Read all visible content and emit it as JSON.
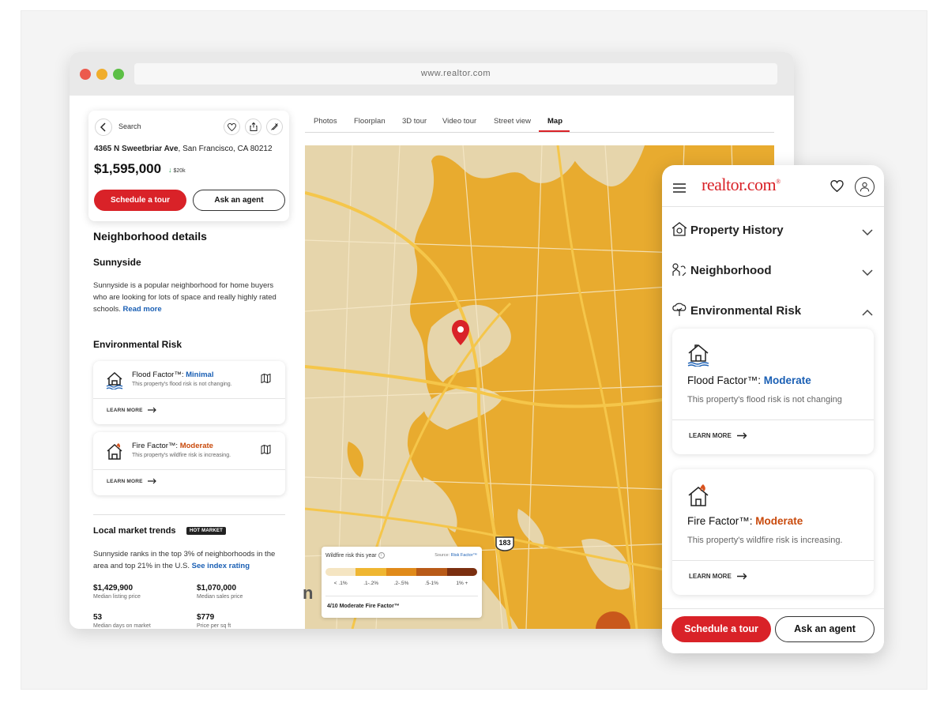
{
  "browser": {
    "url": "www.realtor.com"
  },
  "listing": {
    "back_label": "Search",
    "address_bold": "4365 N Sweetbriar Ave",
    "address_rest": ", San Francisco, CA 80212",
    "price": "$1,595,000",
    "price_change": "$20k",
    "schedule_label": "Schedule a tour",
    "agent_label": "Ask an agent"
  },
  "neighborhood": {
    "section_title": "Neighborhood details",
    "name": "Sunnyside",
    "description": "Sunnyside is a popular neighborhood for home buyers who are looking for lots of space and really highly rated schools.",
    "read_more": "Read more"
  },
  "environmental_risk": {
    "title": "Environmental Risk",
    "flood": {
      "label": "Flood Factor™:",
      "level": "Minimal",
      "sub": "This property's flood risk is not changing.",
      "learn_more": "LEARN MORE"
    },
    "fire": {
      "label": "Fire Factor™:",
      "level": "Moderate",
      "sub": "This property's wildfire risk is increasing.",
      "learn_more": "LEARN MORE"
    }
  },
  "market": {
    "title": "Local market trends",
    "badge": "HOT MARKET",
    "description": "Sunnyside ranks in the top 3% of neighborhoods in the area and top 21% in the U.S.",
    "link": "See index rating",
    "stats": [
      {
        "value": "$1,429,900",
        "label": "Median listing price"
      },
      {
        "value": "$1,070,000",
        "label": "Median sales price"
      },
      {
        "value": "53",
        "label": "Median days on market"
      },
      {
        "value": "$779",
        "label": "Price per sq ft"
      }
    ]
  },
  "tabs": [
    "Photos",
    "Floorplan",
    "3D tour",
    "Video tour",
    "Street view",
    "Map"
  ],
  "active_tab": "Map",
  "map": {
    "highway_number": "183",
    "ghost_letter": "n",
    "legend": {
      "title": "Wildfire risk this year",
      "source_prefix": "Source:",
      "source_link": "Risk Factor™",
      "levels": [
        "< .1%",
        ".1-.2%",
        ".2-.5%",
        ".5-1%",
        "1% +"
      ],
      "colors": [
        "#f5e5c2",
        "#efb631",
        "#e08a1a",
        "#b85a18",
        "#7b2f10"
      ],
      "footer": "4/10 Moderate Fire Factor™"
    }
  },
  "mobile": {
    "logo": "realtor.com",
    "logo_mark": "®",
    "accordions": [
      {
        "label": "Property History",
        "state": "collapsed"
      },
      {
        "label": "Neighborhood",
        "state": "collapsed"
      },
      {
        "label": "Environmental Risk",
        "state": "expanded"
      }
    ],
    "flood": {
      "label": "Flood Factor™:",
      "level": "Moderate",
      "sub": "This property's flood risk is not changing",
      "learn_more": "LEARN MORE"
    },
    "fire": {
      "label": "Fire Factor™:",
      "level": "Moderate",
      "sub": "This property's wildfire risk is increasing.",
      "learn_more": "LEARN MORE"
    },
    "schedule_label": "Schedule a tour",
    "agent_label": "Ask an agent"
  },
  "colors": {
    "brand_red": "#d92228",
    "link_blue": "#1a5fb4",
    "moderate_orange": "#c94a0c"
  }
}
